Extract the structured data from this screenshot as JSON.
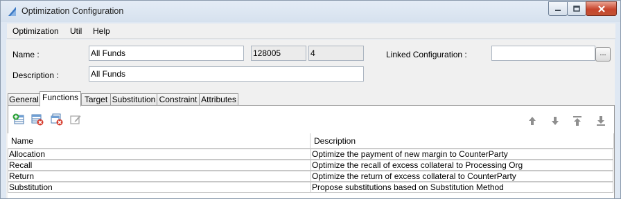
{
  "window": {
    "title": "Optimization Configuration"
  },
  "menu": [
    "Optimization",
    "Util",
    "Help"
  ],
  "form": {
    "name_label": "Name :",
    "name_value": "All Funds",
    "id_value": "128005",
    "version_value": "4",
    "linked_label": "Linked Configuration :",
    "linked_value": "",
    "linked_button": "...",
    "description_label": "Description :",
    "description_value": "All Funds"
  },
  "tabs": [
    "General",
    "Functions",
    "Target",
    "Substitution",
    "Constraint",
    "Attributes"
  ],
  "active_tab": "Functions",
  "toolbar": {
    "left_icons": [
      "add-row-icon",
      "remove-row-icon",
      "remove-all-icon",
      "edit-icon"
    ],
    "right_icons": [
      "move-up-icon",
      "move-down-icon",
      "move-top-icon",
      "move-bottom-icon"
    ]
  },
  "table": {
    "columns": [
      "Name",
      "Description"
    ],
    "rows": [
      {
        "name": "Allocation",
        "description": "Optimize the payment of new margin to CounterParty"
      },
      {
        "name": "Recall",
        "description": "Optimize the recall of excess collateral to Processing Org"
      },
      {
        "name": "Return",
        "description": "Optimize the return of excess collateral to CounterParty"
      },
      {
        "name": "Substitution",
        "description": "Propose substitutions based on Substitution Method"
      }
    ]
  },
  "colors": {
    "titlebar": "#dae4f0",
    "close_button": "#c7452d",
    "panel": "#f0f0f0"
  }
}
